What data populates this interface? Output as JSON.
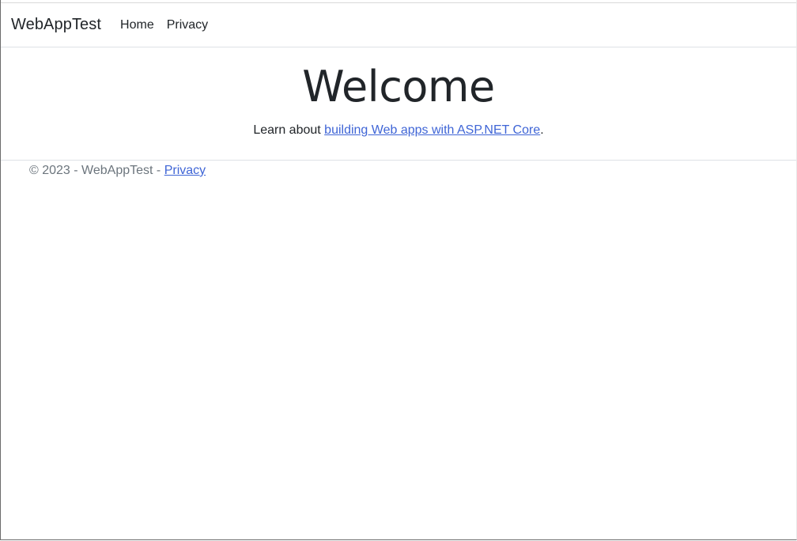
{
  "navbar": {
    "brand": "WebAppTest",
    "links": [
      {
        "label": "Home"
      },
      {
        "label": "Privacy"
      }
    ]
  },
  "main": {
    "heading": "Welcome",
    "learn_prefix": "Learn about ",
    "learn_link": "building Web apps with ASP.NET Core",
    "learn_suffix": "."
  },
  "footer": {
    "text": "© 2023 - WebAppTest - ",
    "link": "Privacy"
  },
  "colors": {
    "link": "#3f65d6",
    "text": "#212529",
    "muted": "#6c757d",
    "border": "#dee2e6"
  }
}
